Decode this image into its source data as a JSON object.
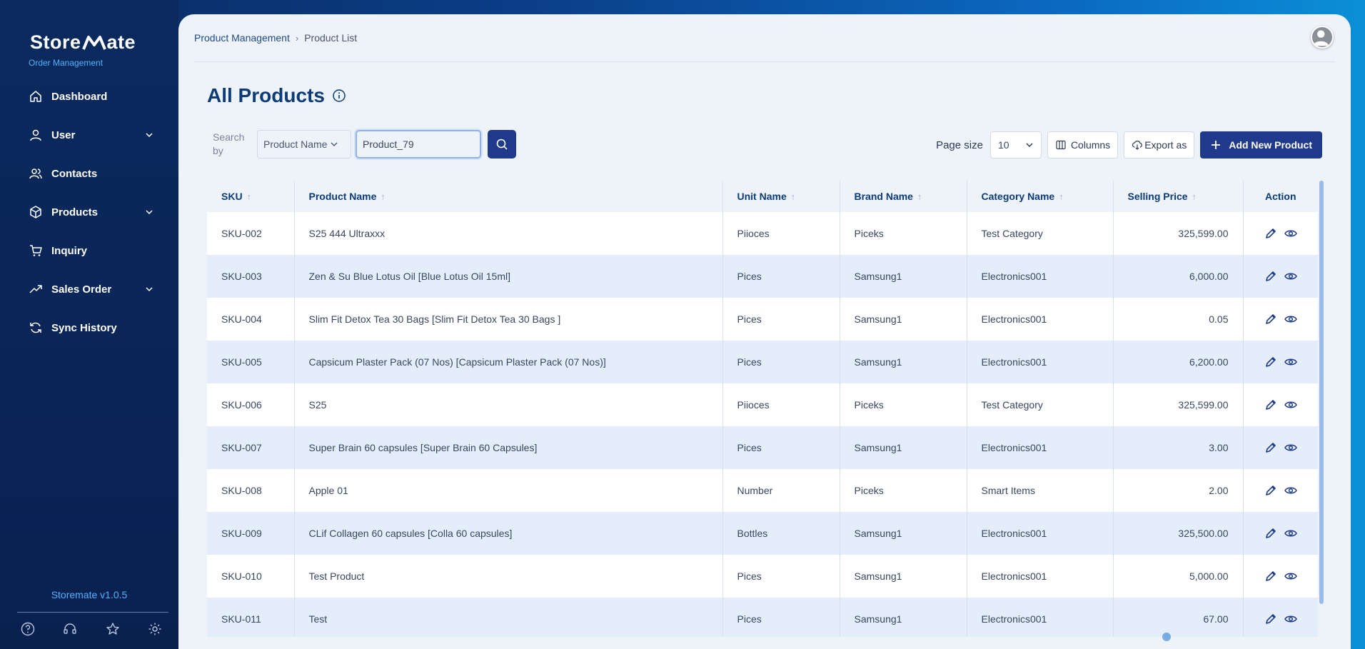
{
  "brand": {
    "name_left": "Store",
    "name_right": "ate",
    "subtitle": "Order Management"
  },
  "sidebar": {
    "items": [
      {
        "label": "Dashboard",
        "icon": "home-icon",
        "expandable": false
      },
      {
        "label": "User",
        "icon": "user-icon",
        "expandable": true
      },
      {
        "label": "Contacts",
        "icon": "contacts-icon",
        "expandable": false
      },
      {
        "label": "Products",
        "icon": "box-icon",
        "expandable": true
      },
      {
        "label": "Inquiry",
        "icon": "cart-icon",
        "expandable": false
      },
      {
        "label": "Sales Order",
        "icon": "trend-icon",
        "expandable": true
      },
      {
        "label": "Sync History",
        "icon": "sync-icon",
        "expandable": false
      }
    ],
    "version": "Storemate v1.0.5",
    "footer_icons": [
      "help-icon",
      "headset-icon",
      "star-icon",
      "settings-icon"
    ]
  },
  "breadcrumb": {
    "parent": "Product Management",
    "current": "Product List"
  },
  "page": {
    "title": "All Products"
  },
  "search": {
    "label": "Search by",
    "field": "Product Name",
    "value": "Product_79"
  },
  "toolbar": {
    "page_size_label": "Page size",
    "page_size": "10",
    "columns_label": "Columns",
    "export_label": "Export as",
    "add_label": "Add New Product"
  },
  "table": {
    "headers": {
      "sku": "SKU",
      "product_name": "Product Name",
      "unit_name": "Unit Name",
      "brand_name": "Brand Name",
      "category_name": "Category Name",
      "selling_price": "Selling Price",
      "action": "Action"
    },
    "rows": [
      {
        "sku": "SKU-002",
        "name": "S25 444 Ultraxxx",
        "unit": "Piioces",
        "brand": "Piceks",
        "category": "Test Category",
        "price": "325,599.00"
      },
      {
        "sku": "SKU-003",
        "name": "Zen & Su Blue Lotus Oil [Blue Lotus Oil 15ml]",
        "unit": "Pices",
        "brand": "Samsung1",
        "category": "Electronics001",
        "price": "6,000.00"
      },
      {
        "sku": "SKU-004",
        "name": "Slim Fit Detox Tea 30 Bags [Slim Fit Detox Tea 30 Bags ]",
        "unit": "Pices",
        "brand": "Samsung1",
        "category": "Electronics001",
        "price": "0.05"
      },
      {
        "sku": "SKU-005",
        "name": "Capsicum Plaster Pack (07 Nos) [Capsicum Plaster Pack (07 Nos)]",
        "unit": "Pices",
        "brand": "Samsung1",
        "category": "Electronics001",
        "price": "6,200.00"
      },
      {
        "sku": "SKU-006",
        "name": "S25",
        "unit": "Piioces",
        "brand": "Piceks",
        "category": "Test Category",
        "price": "325,599.00"
      },
      {
        "sku": "SKU-007",
        "name": "Super Brain 60 capsules [Super Brain 60 Capsules]",
        "unit": "Pices",
        "brand": "Samsung1",
        "category": "Electronics001",
        "price": "3.00"
      },
      {
        "sku": "SKU-008",
        "name": "Apple 01",
        "unit": "Number",
        "brand": "Piceks",
        "category": "Smart Items",
        "price": "2.00"
      },
      {
        "sku": "SKU-009",
        "name": "CLif Collagen 60 capsules [Colla 60 capsules]",
        "unit": "Bottles",
        "brand": "Samsung1",
        "category": "Electronics001",
        "price": "325,500.00"
      },
      {
        "sku": "SKU-010",
        "name": "Test Product",
        "unit": "Pices",
        "brand": "Samsung1",
        "category": "Electronics001",
        "price": "5,000.00"
      },
      {
        "sku": "SKU-011",
        "name": "Test",
        "unit": "Pices",
        "brand": "Samsung1",
        "category": "Electronics001",
        "price": "67.00"
      }
    ]
  },
  "colors": {
    "primary": "#1f3a8a",
    "title": "#0c3b78",
    "accent": "#4fb3ff",
    "row_alt": "#e4eefb"
  }
}
